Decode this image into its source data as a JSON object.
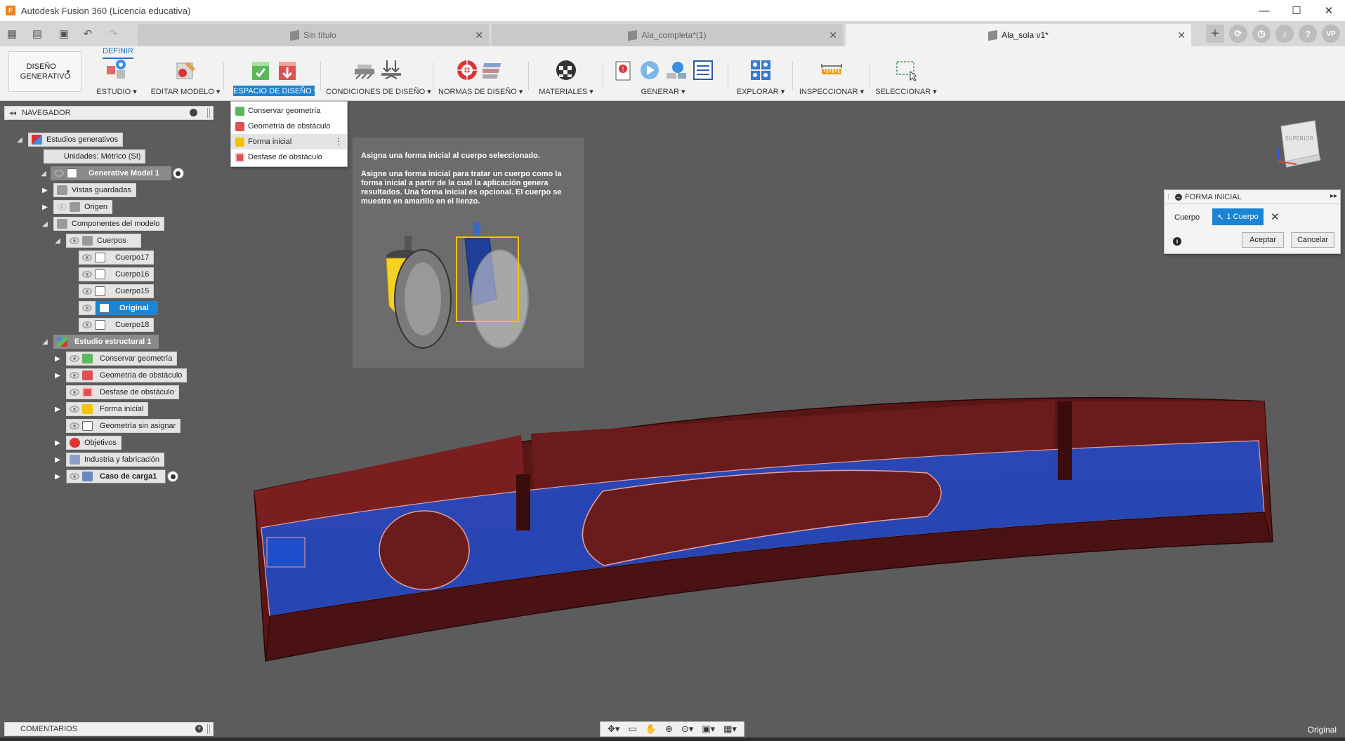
{
  "window": {
    "title": "Autodesk Fusion 360 (Licencia educativa)",
    "app_icon": "F",
    "controls": [
      "—",
      "☐",
      "✕"
    ]
  },
  "tabs": [
    {
      "label": "Sin título",
      "active": false
    },
    {
      "label": "Ala_completa*(1)",
      "active": false
    },
    {
      "label": "Ala_sola v1*",
      "active": true
    }
  ],
  "account": {
    "initials": "VP"
  },
  "ribbon": {
    "workspace": "DISEÑO GENERATIVO",
    "active_tab": "DEFINIR",
    "groups": {
      "estudio": "ESTUDIO ▾",
      "editar_modelo": "EDITAR MODELO ▾",
      "espacio_diseno": "ESPACIO DE DISEÑO ▾",
      "condiciones": "CONDICIONES DE DISEÑO ▾",
      "normas": "NORMAS DE DISEÑO ▾",
      "materiales": "MATERIALES ▾",
      "generar": "GENERAR ▾",
      "explorar": "EXPLORAR ▾",
      "inspeccionar": "INSPECCIONAR ▾",
      "seleccionar": "SELECCIONAR ▾"
    }
  },
  "dropdown": {
    "items": [
      {
        "label": "Conservar geometría",
        "color": "#2ea043"
      },
      {
        "label": "Geometría de obstáculo",
        "color": "#d93a3a"
      },
      {
        "label": "Forma inicial",
        "color": "#f2c400"
      },
      {
        "label": "Desfase de obstáculo",
        "color": "#d93a3a"
      }
    ],
    "highlighted": "Forma inicial",
    "more": "⋮"
  },
  "tooltip": {
    "title": "Asigna una forma inicial al cuerpo seleccionado.",
    "body": "Asigne una forma inicial para tratar un cuerpo como la forma inicial a partir de la cual la aplicación genera resultados. Una forma inicial es opcional. El cuerpo se muestra en amarillo en el lienzo."
  },
  "navigator": {
    "title": "NAVEGADOR",
    "nodes": {
      "root": "Estudios generativos",
      "units": "Unidades: Métrico (SI)",
      "model": "Generative Model 1",
      "saved_views": "Vistas guardadas",
      "origin": "Origen",
      "components": "Componentes del modelo",
      "bodies": "Cuerpos",
      "b17": "Cuerpo17",
      "b16": "Cuerpo16",
      "b15": "Cuerpo15",
      "original": "Original",
      "b18": "Cuerpo18",
      "study": "Estudio estructural 1",
      "preserve": "Conservar geometría",
      "obstacle": "Geometría de obstáculo",
      "offset": "Desfase de obstáculo",
      "starting": "Forma inicial",
      "unassigned": "Geometría sin asignar",
      "objectives": "Objetivos",
      "manufacturing": "Industria y fabricación",
      "loadcase": "Caso de carga1"
    }
  },
  "viewcube": {
    "face": "SUPERIOR"
  },
  "panel": {
    "title": "FORMA INICIAL",
    "body_label": "Cuerpo",
    "selection": "1 Cuerpo",
    "ok": "Aceptar",
    "cancel": "Cancelar"
  },
  "comments": {
    "title": "COMENTARIOS"
  },
  "status": {
    "selected": "Original"
  },
  "colors": {
    "accent": "#1a84d6",
    "viewport": "#5c5c5c",
    "preserve": "#2ea043",
    "obstacle": "#d93a3a",
    "starting": "#f2c400",
    "model_red": "#6a1b1b",
    "model_blue": "#1f4fd0"
  }
}
